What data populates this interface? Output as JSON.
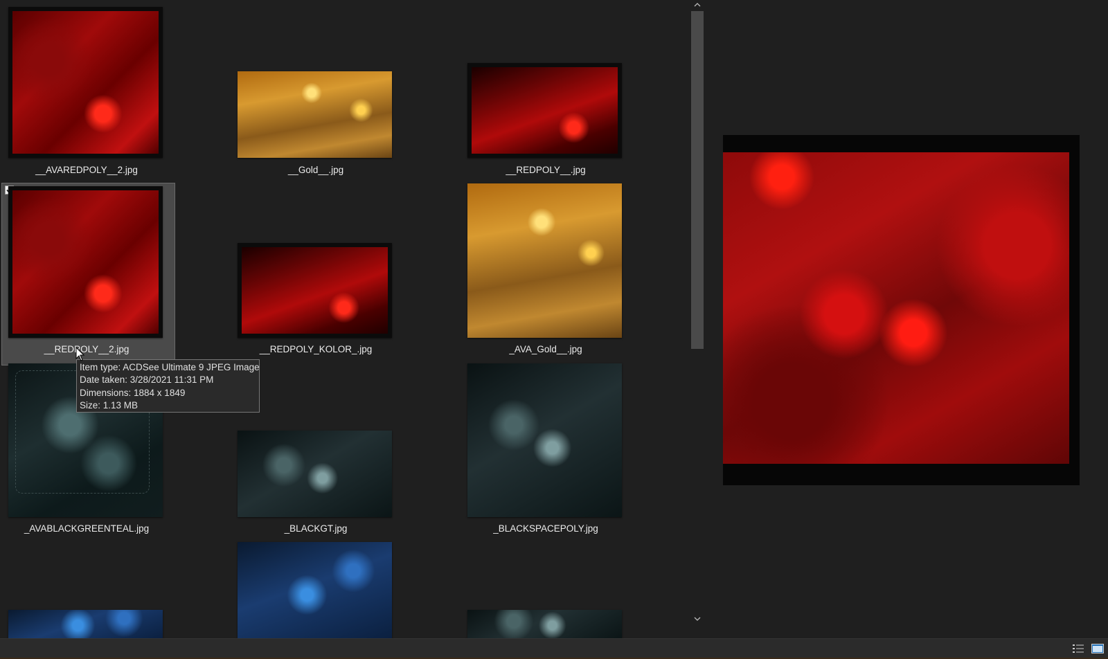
{
  "thumbnails": [
    {
      "label": "__AVAREDPOLY__2.jpg"
    },
    {
      "label": "__Gold__.jpg"
    },
    {
      "label": "__REDPOLY__.jpg"
    },
    {
      "label": "__REDPOLY__2.jpg"
    },
    {
      "label": "__REDPOLY_KOLOR_.jpg"
    },
    {
      "label": "_AVA_Gold__.jpg"
    },
    {
      "label": "_AVABLACKGREENTEAL.jpg"
    },
    {
      "label": "_BLACKGT.jpg"
    },
    {
      "label": "_BLACKSPACEPOLY.jpg"
    }
  ],
  "tooltip": {
    "item_type": "Item type: ACDSee Ultimate 9 JPEG Image",
    "date_taken": "Date taken: 3/28/2021 11:31 PM",
    "dimensions": "Dimensions: 1884 x 1849",
    "size": "Size: 1.13 MB"
  },
  "colors": {
    "background": "#1f1f1f",
    "selection": "#4a4a4a",
    "text": "#ececec"
  },
  "icons": {
    "checkbox": "checkmark-icon",
    "details_view": "details-view-icon",
    "preview_view": "preview-pane-icon"
  }
}
